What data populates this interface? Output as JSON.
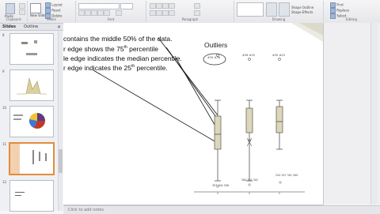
{
  "ribbon": {
    "groups": [
      {
        "label": "Clipboard",
        "buttons": [
          "Paste"
        ]
      },
      {
        "label": "Slides",
        "buttons": [
          "New Slide",
          "Layout",
          "Reset",
          "Delete"
        ]
      },
      {
        "label": "Font",
        "buttons": []
      },
      {
        "label": "Paragraph",
        "buttons": []
      },
      {
        "label": "Drawing",
        "buttons": [
          "Shape Outline",
          "Shape Effects"
        ]
      },
      {
        "label": "Editing",
        "buttons": [
          "Find",
          "Replace",
          "Select"
        ]
      }
    ]
  },
  "panel": {
    "tabs": [
      "Slides",
      "Outline"
    ],
    "close": "×",
    "slide_numbers": [
      "8",
      "9",
      "10",
      "11",
      "12"
    ]
  },
  "slide": {
    "lines": [
      "contains the middle 50% of the data.",
      "r edge shows the 75",
      "le edge indicates the median percentile.",
      "r edge indicates the 25"
    ],
    "line_suffixes": [
      "",
      " percentile",
      "",
      " percentile."
    ],
    "line_sups": [
      "",
      "th",
      "",
      "th"
    ],
    "chart_title": "Outliers",
    "outlier_labels_top": [
      "#35  #38",
      "#36  #35",
      "#30  #25"
    ],
    "outlier_labels_bottom": [
      "307  304\n308",
      "300\n301  302",
      "254\n347\n301  300"
    ]
  },
  "notes": {
    "placeholder": "Click to add notes"
  },
  "colors": {
    "box_fill": "#dcd7b8",
    "box_stroke": "#555555",
    "selected_thumb": "#e38b3c",
    "ribbon_bg": "#e6e7ea"
  }
}
